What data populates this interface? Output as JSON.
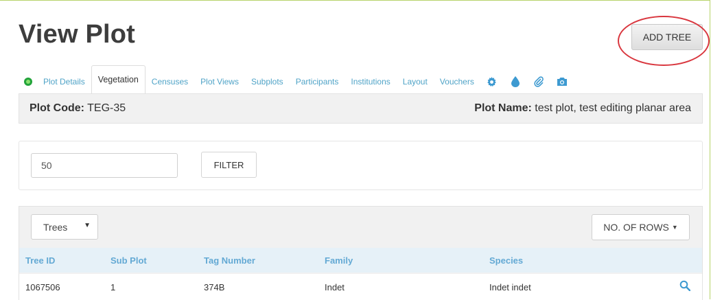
{
  "page": {
    "title": "View Plot"
  },
  "header": {
    "add_tree_label": "ADD TREE"
  },
  "tabs": [
    {
      "label": "Plot Details"
    },
    {
      "label": "Vegetation",
      "active": true
    },
    {
      "label": "Censuses"
    },
    {
      "label": "Plot Views"
    },
    {
      "label": "Subplots"
    },
    {
      "label": "Participants"
    },
    {
      "label": "Institutions"
    },
    {
      "label": "Layout"
    },
    {
      "label": "Vouchers"
    }
  ],
  "tab_icons": [
    "status-indicator-icon",
    "gear-icon",
    "water-drop-icon",
    "paperclip-icon",
    "camera-icon"
  ],
  "info": {
    "plot_code_label": "Plot Code:",
    "plot_code_value": "TEG-35",
    "plot_name_label": "Plot Name:",
    "plot_name_value": "test plot, test editing planar area"
  },
  "filter": {
    "input_value": "50",
    "button_label": "FILTER"
  },
  "table_controls": {
    "select_value": "Trees",
    "rows_button_label": "NO. OF ROWS"
  },
  "table": {
    "headers": [
      "Tree ID",
      "Sub Plot",
      "Tag Number",
      "Family",
      "Species"
    ],
    "rows": [
      [
        "1067506",
        "1",
        "374B",
        "Indet",
        "Indet indet"
      ]
    ]
  },
  "colors": {
    "accent_blue": "#4fa3c7",
    "header_text": "#63a9d4",
    "highlight_ring": "#d9363e",
    "status_green": "#22a33a"
  }
}
